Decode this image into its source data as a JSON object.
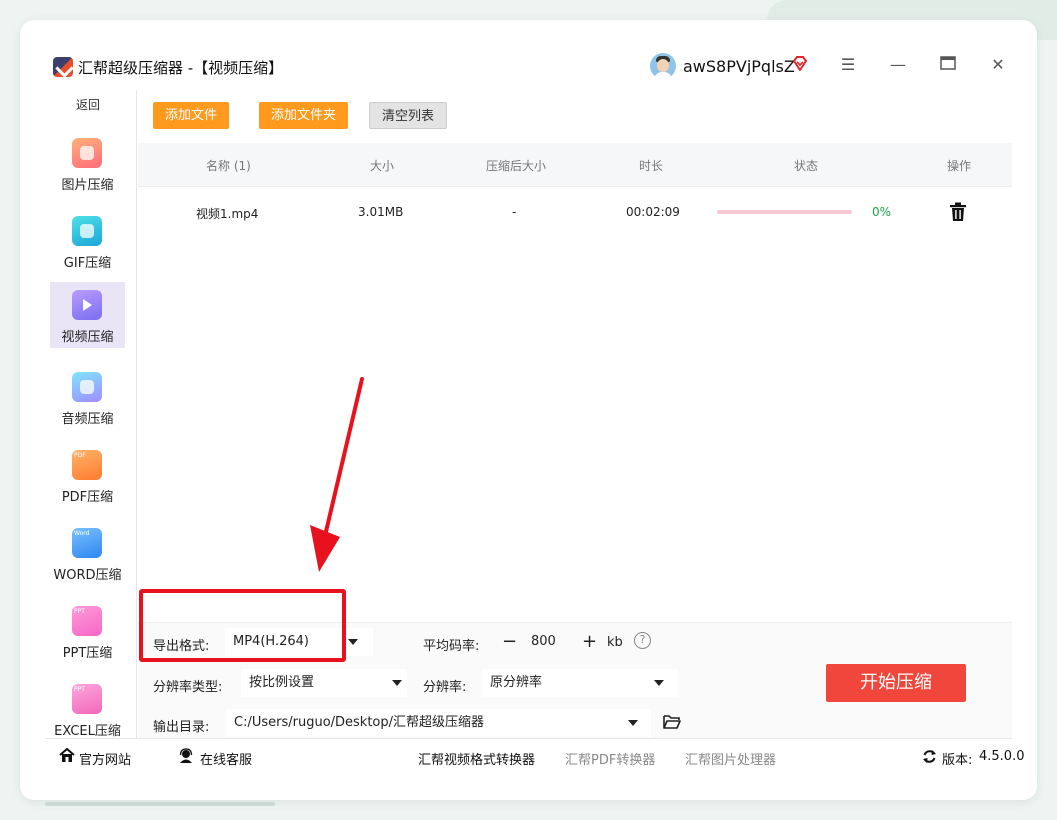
{
  "window": {
    "title": "汇帮超级压缩器 -【视频压缩】",
    "username": "awS8PVjPqlsZ"
  },
  "sidebar": {
    "back": "返回",
    "items": [
      {
        "label": "图片压缩"
      },
      {
        "label": "GIF压缩"
      },
      {
        "label": "视频压缩",
        "active": true
      },
      {
        "label": "音频压缩"
      },
      {
        "label": "PDF压缩"
      },
      {
        "label": "WORD压缩"
      },
      {
        "label": "PPT压缩"
      },
      {
        "label": "EXCEL压缩"
      }
    ],
    "icon_tags": {
      "pdf": "PDF",
      "word": "Word",
      "ppt": "PPT",
      "excel": "PPT"
    }
  },
  "toolbar": {
    "add_file": "添加文件",
    "add_folder": "添加文件夹",
    "clear_list": "清空列表"
  },
  "table": {
    "headers": [
      "名称 (1)",
      "大小",
      "压缩后大小",
      "时长",
      "状态",
      "操作"
    ],
    "rows": [
      {
        "name": "视频1.mp4",
        "size": "3.01MB",
        "compressed_size": "-",
        "duration": "00:02:09",
        "progress": 0,
        "progress_text": "0%"
      }
    ]
  },
  "settings": {
    "format_label": "导出格式:",
    "format_value": "MP4(H.264)",
    "bitrate_label": "平均码率:",
    "bitrate_value": "800",
    "bitrate_unit": "kb",
    "bitrate_minus": "−",
    "bitrate_plus": "+",
    "help": "?",
    "resolution_type_label": "分辨率类型:",
    "resolution_type_value": "按比例设置",
    "resolution_label": "分辨率:",
    "resolution_value": "原分辨率",
    "output_label": "输出目录:",
    "output_value": "C:/Users/ruguo/Desktop/汇帮超级压缩器",
    "start_button": "开始压缩"
  },
  "footer": {
    "website": "官方网站",
    "support": "在线客服",
    "video_converter": "汇帮视频格式转换器",
    "pdf_converter": "汇帮PDF转换器",
    "image_processor": "汇帮图片处理器",
    "version_label": "版本:",
    "version": "4.5.0.0"
  },
  "colors": {
    "accent_orange": "#ff9a1f",
    "start_red": "#f0463c",
    "annotation_red": "#e8121f",
    "progress_green": "#1aa34a"
  }
}
